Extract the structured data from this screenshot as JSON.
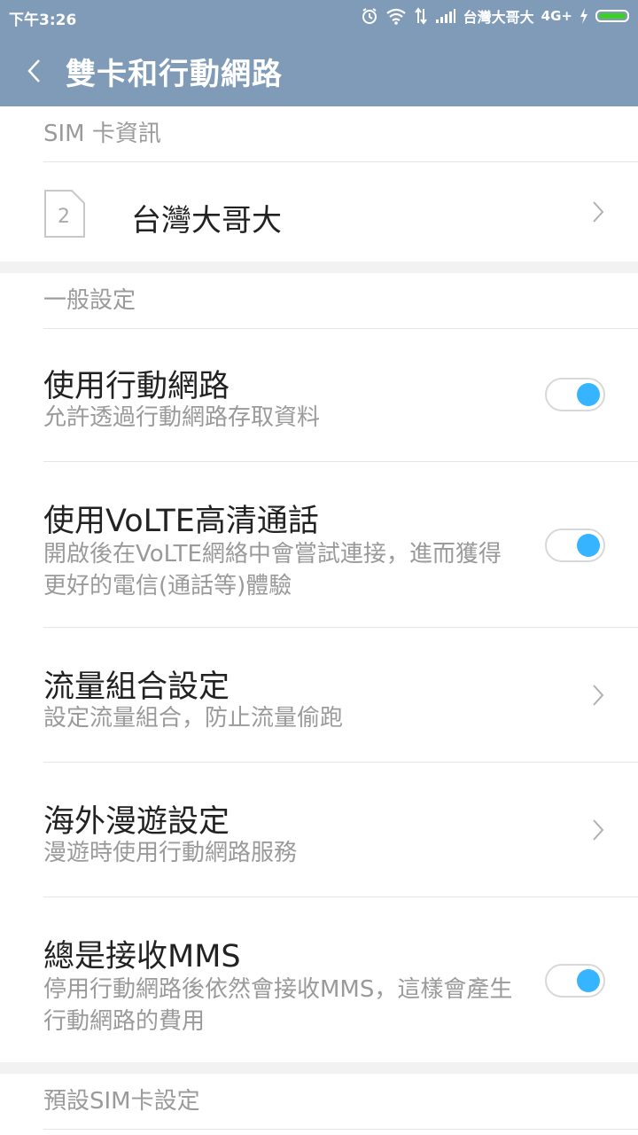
{
  "status": {
    "time": "下午3:26",
    "carrier": "台灣大哥大",
    "network": "4G+"
  },
  "header": {
    "title": "雙卡和行動網路"
  },
  "sim_section": {
    "header": "SIM 卡資訊",
    "slot_number": "2",
    "carrier": "台灣大哥大"
  },
  "general": {
    "header": "一般設定",
    "items": [
      {
        "title": "使用行動網路",
        "subtitle": "允許透過行動網路存取資料",
        "type": "toggle",
        "on": true
      },
      {
        "title": "使用VoLTE高清通話",
        "subtitle": "開啟後在VoLTE網絡中會嘗試連接，進而獲得更好的電信(通話等)體驗",
        "type": "toggle",
        "on": true
      },
      {
        "title": "流量組合設定",
        "subtitle": "設定流量組合，防止流量偷跑",
        "type": "link"
      },
      {
        "title": "海外漫遊設定",
        "subtitle": "漫遊時使用行動網路服務",
        "type": "link"
      },
      {
        "title": "總是接收MMS",
        "subtitle": "停用行動網路後依然會接收MMS，這樣會產生行動網路的費用",
        "type": "toggle",
        "on": true
      }
    ]
  },
  "default_sim": {
    "header": "預設SIM卡設定"
  },
  "colors": {
    "header_bg": "#7f9bb8",
    "toggle_on": "#36b4ff",
    "battery": "#3ccf24"
  }
}
